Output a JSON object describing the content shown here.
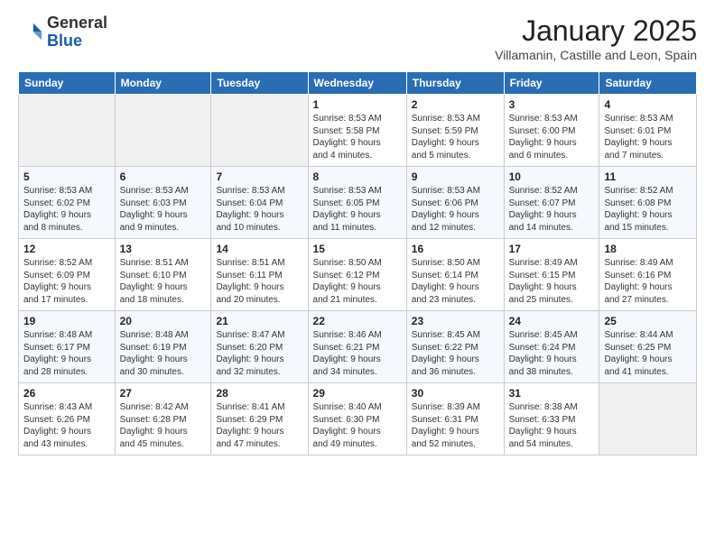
{
  "header": {
    "logo_general": "General",
    "logo_blue": "Blue",
    "main_title": "January 2025",
    "subtitle": "Villamanin, Castille and Leon, Spain"
  },
  "calendar": {
    "days_of_week": [
      "Sunday",
      "Monday",
      "Tuesday",
      "Wednesday",
      "Thursday",
      "Friday",
      "Saturday"
    ],
    "weeks": [
      [
        {
          "day": "",
          "info": ""
        },
        {
          "day": "",
          "info": ""
        },
        {
          "day": "",
          "info": ""
        },
        {
          "day": "1",
          "info": "Sunrise: 8:53 AM\nSunset: 5:58 PM\nDaylight: 9 hours\nand 4 minutes."
        },
        {
          "day": "2",
          "info": "Sunrise: 8:53 AM\nSunset: 5:59 PM\nDaylight: 9 hours\nand 5 minutes."
        },
        {
          "day": "3",
          "info": "Sunrise: 8:53 AM\nSunset: 6:00 PM\nDaylight: 9 hours\nand 6 minutes."
        },
        {
          "day": "4",
          "info": "Sunrise: 8:53 AM\nSunset: 6:01 PM\nDaylight: 9 hours\nand 7 minutes."
        }
      ],
      [
        {
          "day": "5",
          "info": "Sunrise: 8:53 AM\nSunset: 6:02 PM\nDaylight: 9 hours\nand 8 minutes."
        },
        {
          "day": "6",
          "info": "Sunrise: 8:53 AM\nSunset: 6:03 PM\nDaylight: 9 hours\nand 9 minutes."
        },
        {
          "day": "7",
          "info": "Sunrise: 8:53 AM\nSunset: 6:04 PM\nDaylight: 9 hours\nand 10 minutes."
        },
        {
          "day": "8",
          "info": "Sunrise: 8:53 AM\nSunset: 6:05 PM\nDaylight: 9 hours\nand 11 minutes."
        },
        {
          "day": "9",
          "info": "Sunrise: 8:53 AM\nSunset: 6:06 PM\nDaylight: 9 hours\nand 12 minutes."
        },
        {
          "day": "10",
          "info": "Sunrise: 8:52 AM\nSunset: 6:07 PM\nDaylight: 9 hours\nand 14 minutes."
        },
        {
          "day": "11",
          "info": "Sunrise: 8:52 AM\nSunset: 6:08 PM\nDaylight: 9 hours\nand 15 minutes."
        }
      ],
      [
        {
          "day": "12",
          "info": "Sunrise: 8:52 AM\nSunset: 6:09 PM\nDaylight: 9 hours\nand 17 minutes."
        },
        {
          "day": "13",
          "info": "Sunrise: 8:51 AM\nSunset: 6:10 PM\nDaylight: 9 hours\nand 18 minutes."
        },
        {
          "day": "14",
          "info": "Sunrise: 8:51 AM\nSunset: 6:11 PM\nDaylight: 9 hours\nand 20 minutes."
        },
        {
          "day": "15",
          "info": "Sunrise: 8:50 AM\nSunset: 6:12 PM\nDaylight: 9 hours\nand 21 minutes."
        },
        {
          "day": "16",
          "info": "Sunrise: 8:50 AM\nSunset: 6:14 PM\nDaylight: 9 hours\nand 23 minutes."
        },
        {
          "day": "17",
          "info": "Sunrise: 8:49 AM\nSunset: 6:15 PM\nDaylight: 9 hours\nand 25 minutes."
        },
        {
          "day": "18",
          "info": "Sunrise: 8:49 AM\nSunset: 6:16 PM\nDaylight: 9 hours\nand 27 minutes."
        }
      ],
      [
        {
          "day": "19",
          "info": "Sunrise: 8:48 AM\nSunset: 6:17 PM\nDaylight: 9 hours\nand 28 minutes."
        },
        {
          "day": "20",
          "info": "Sunrise: 8:48 AM\nSunset: 6:19 PM\nDaylight: 9 hours\nand 30 minutes."
        },
        {
          "day": "21",
          "info": "Sunrise: 8:47 AM\nSunset: 6:20 PM\nDaylight: 9 hours\nand 32 minutes."
        },
        {
          "day": "22",
          "info": "Sunrise: 8:46 AM\nSunset: 6:21 PM\nDaylight: 9 hours\nand 34 minutes."
        },
        {
          "day": "23",
          "info": "Sunrise: 8:45 AM\nSunset: 6:22 PM\nDaylight: 9 hours\nand 36 minutes."
        },
        {
          "day": "24",
          "info": "Sunrise: 8:45 AM\nSunset: 6:24 PM\nDaylight: 9 hours\nand 38 minutes."
        },
        {
          "day": "25",
          "info": "Sunrise: 8:44 AM\nSunset: 6:25 PM\nDaylight: 9 hours\nand 41 minutes."
        }
      ],
      [
        {
          "day": "26",
          "info": "Sunrise: 8:43 AM\nSunset: 6:26 PM\nDaylight: 9 hours\nand 43 minutes."
        },
        {
          "day": "27",
          "info": "Sunrise: 8:42 AM\nSunset: 6:28 PM\nDaylight: 9 hours\nand 45 minutes."
        },
        {
          "day": "28",
          "info": "Sunrise: 8:41 AM\nSunset: 6:29 PM\nDaylight: 9 hours\nand 47 minutes."
        },
        {
          "day": "29",
          "info": "Sunrise: 8:40 AM\nSunset: 6:30 PM\nDaylight: 9 hours\nand 49 minutes."
        },
        {
          "day": "30",
          "info": "Sunrise: 8:39 AM\nSunset: 6:31 PM\nDaylight: 9 hours\nand 52 minutes."
        },
        {
          "day": "31",
          "info": "Sunrise: 8:38 AM\nSunset: 6:33 PM\nDaylight: 9 hours\nand 54 minutes."
        },
        {
          "day": "",
          "info": ""
        }
      ]
    ]
  }
}
